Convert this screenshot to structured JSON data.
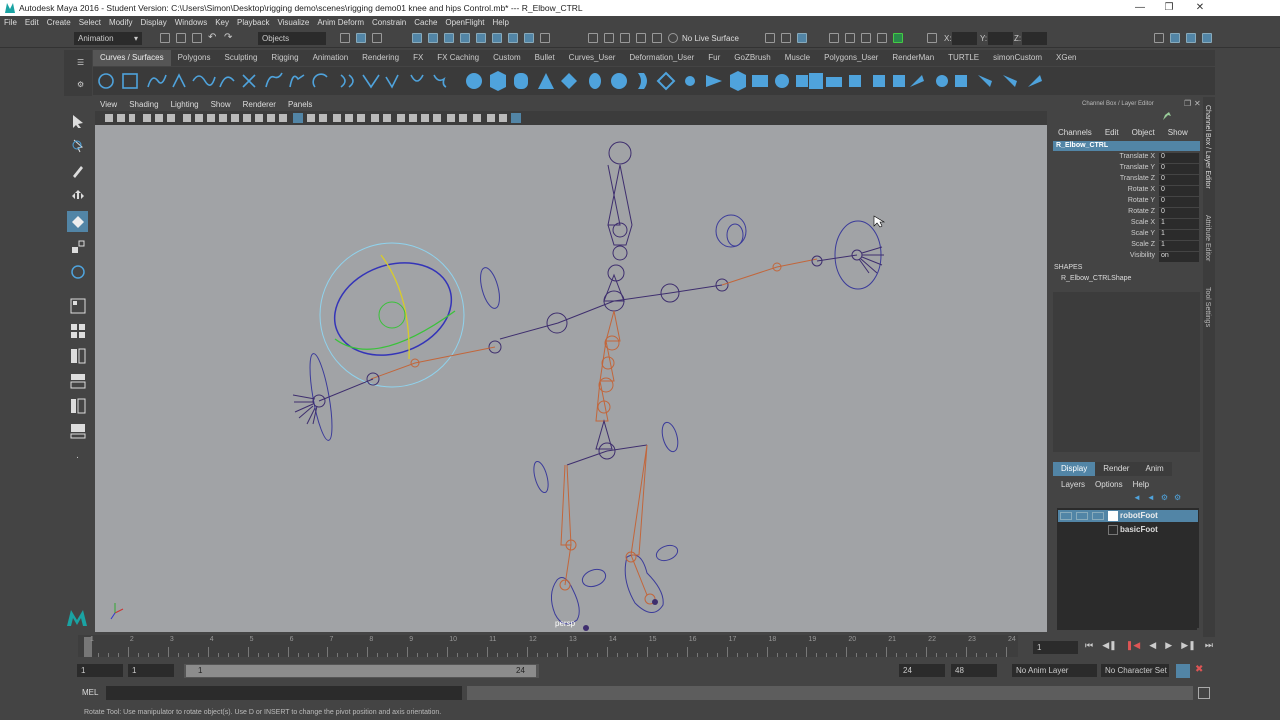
{
  "title": "Autodesk Maya 2016 - Student Version: C:\\Users\\Simon\\Desktop\\rigging demo\\scenes\\rigging demo01 knee and hips Control.mb*   ---   R_Elbow_CTRL",
  "menu": [
    "File",
    "Edit",
    "Create",
    "Select",
    "Modify",
    "Display",
    "Windows",
    "Key",
    "Playback",
    "Visualize",
    "Anim Deform",
    "Constrain",
    "Cache",
    "OpenFlight",
    "Help"
  ],
  "status": {
    "menuset": "Animation",
    "objects": "Objects",
    "live_surface": "No Live Surface",
    "x": "X:",
    "y": "Y:",
    "z": "Z:"
  },
  "shelf_tabs": [
    "Curves / Surfaces",
    "Polygons",
    "Sculpting",
    "Rigging",
    "Animation",
    "Rendering",
    "FX",
    "FX Caching",
    "Custom",
    "Bullet",
    "Curves_User",
    "Deformation_User",
    "Fur",
    "GoZBrush",
    "Muscle",
    "Polygons_User",
    "RenderMan",
    "TURTLE",
    "simonCustom",
    "XGen"
  ],
  "panel_menu": [
    "View",
    "Shading",
    "Lighting",
    "Show",
    "Renderer",
    "Panels"
  ],
  "viewport": {
    "camera": "persp"
  },
  "channel_box": {
    "header": "Channel Box / Layer Editor",
    "menu": [
      "Channels",
      "Edit",
      "Object",
      "Show"
    ],
    "node": "R_Elbow_CTRL",
    "attrs": [
      {
        "label": "Translate X",
        "value": "0"
      },
      {
        "label": "Translate Y",
        "value": "0"
      },
      {
        "label": "Translate Z",
        "value": "0"
      },
      {
        "label": "Rotate X",
        "value": "0"
      },
      {
        "label": "Rotate Y",
        "value": "0"
      },
      {
        "label": "Rotate Z",
        "value": "0"
      },
      {
        "label": "Scale X",
        "value": "1"
      },
      {
        "label": "Scale Y",
        "value": "1"
      },
      {
        "label": "Scale Z",
        "value": "1"
      },
      {
        "label": "Visibility",
        "value": "on"
      }
    ],
    "shapes_label": "SHAPES",
    "shape_node": "R_Elbow_CTRLShape"
  },
  "side_tabs": [
    "Channel Box / Layer Editor",
    "Attribute Editor",
    "Tool Settings"
  ],
  "layer_editor": {
    "tabs": [
      "Display",
      "Render",
      "Anim"
    ],
    "menu": [
      "Layers",
      "Options",
      "Help"
    ],
    "layers": [
      "robotFoot",
      "basicFoot"
    ]
  },
  "timeline": {
    "ticks": [
      "1",
      "2",
      "3",
      "4",
      "5",
      "6",
      "7",
      "8",
      "9",
      "10",
      "11",
      "12",
      "13",
      "14",
      "15",
      "16",
      "17",
      "18",
      "19",
      "20",
      "21",
      "22",
      "23",
      "24"
    ],
    "current_frame": "1"
  },
  "range": {
    "start": "1",
    "playback_start": "1",
    "slider_start": "1",
    "slider_end": "24",
    "playback_end": "24",
    "end": "48",
    "anim_layer": "No Anim Layer",
    "char_set": "No Character Set"
  },
  "cmd": {
    "label": "MEL"
  },
  "help_line": "Rotate Tool: Use manipulator to rotate object(s). Use D or INSERT to change the pivot position and axis orientation.",
  "colors": {
    "accent": "#5285a6",
    "viewport_bg": "#a1a3a6",
    "joint_orange": "#c2663b",
    "joint_purple": "#3e2e6e"
  }
}
